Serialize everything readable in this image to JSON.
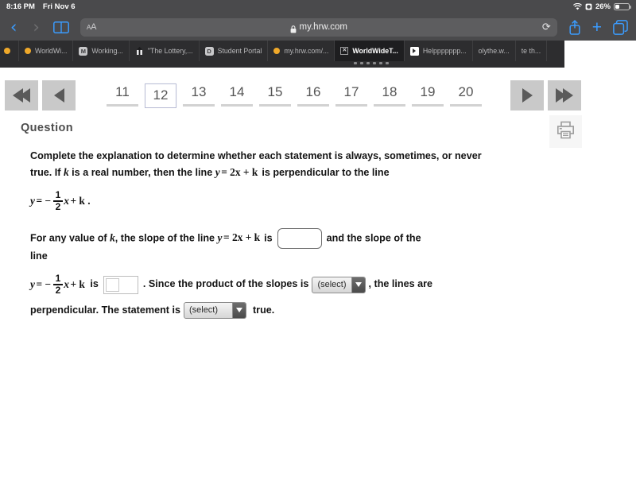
{
  "status_bar": {
    "time": "8:16 PM",
    "date": "Fri Nov 6",
    "battery_percent": "26%",
    "wifi_icon": "wifi-icon",
    "alarm_icon": "alarm-clock-icon",
    "battery_icon": "battery-icon"
  },
  "toolbar": {
    "back_icon": "chevron-left-icon",
    "forward_icon": "chevron-right-icon",
    "bookmarks_icon": "book-icon",
    "text_size_label": "A",
    "text_size_label_small": "A",
    "lock_icon": "lock-icon",
    "url": "my.hrw.com",
    "reload_icon": "reload-icon",
    "share_icon": "share-icon",
    "new_tab_icon": "plus-icon",
    "tabs_icon": "tabs-icon"
  },
  "tabs": [
    {
      "title": "",
      "favicon": "dot-favicon",
      "active": false
    },
    {
      "title": "WorldWi...",
      "favicon": "dot-favicon",
      "active": false
    },
    {
      "title": "Working...",
      "favicon": "letter-m-favicon",
      "active": false
    },
    {
      "title": "\"The Lottery,...",
      "favicon": "pin-favicon",
      "active": false
    },
    {
      "title": "Student Portal",
      "favicon": "letter-d-favicon",
      "active": false
    },
    {
      "title": "my.hrw.com/...",
      "favicon": "dot-favicon",
      "active": false
    },
    {
      "title": "WorldWideT...",
      "favicon": "x-favicon",
      "active": true
    },
    {
      "title": "Helppppppp...",
      "favicon": "play-favicon",
      "active": false
    },
    {
      "title": "olythe.w...",
      "favicon": "none",
      "active": false
    },
    {
      "title": "te th...",
      "favicon": "none",
      "active": false
    }
  ],
  "pager": {
    "first_icon": "double-chevron-left-icon",
    "prev_icon": "chevron-left-icon",
    "next_icon": "chevron-right-icon",
    "last_icon": "double-chevron-right-icon",
    "pages": [
      "11",
      "12",
      "13",
      "14",
      "15",
      "16",
      "17",
      "18",
      "19",
      "20"
    ],
    "current_page": "12"
  },
  "question": {
    "heading": "Question",
    "print_icon": "printer-icon",
    "intro_part1": "Complete the explanation to determine whether each statement is always, sometimes, or never true. If ",
    "intro_k": "k",
    "intro_part2": " is a real number, then the line ",
    "intro_eq_y": "y",
    "intro_eq_rest": "= 2x + k",
    "intro_part3": " is perpendicular to the line",
    "eq1_y": "y",
    "eq1_eq": "= −",
    "eq1_num": "1",
    "eq1_den": "2",
    "eq1_x": "x",
    "eq1_tail": "+ k .",
    "p2_a": "For any value of ",
    "p2_k": "k",
    "p2_b": ", the slope of the line ",
    "p2_eq_y": "y",
    "p2_eq_rest": "= 2x + k",
    "p2_is": " is",
    "p2_c": "and the slope of the",
    "p2_d": "line",
    "slope_input_1_value": "",
    "slope_input_2_value": "",
    "eq2_y": "y",
    "eq2_eq": "= −",
    "eq2_num": "1",
    "eq2_den": "2",
    "eq2_x": "x",
    "eq2_tail": "+ k",
    "eq2_is": "is",
    "p3_a": ". Since the product of the slopes is",
    "p3_b": ", the lines are",
    "p4_a": "perpendicular. The statement is",
    "p4_b": "true.",
    "select_product_value": "(select)",
    "select_truth_value": "(select)",
    "select_options": [
      "(select)"
    ]
  },
  "colors": {
    "chrome": "#4a4a4c",
    "tab_strip": "#2d2d2f",
    "tab_active": "#1e1e20",
    "accent_blue": "#3b9cff",
    "favicon_orange": "#f0a92a",
    "pager_button": "#c9c9c9",
    "pager_underline": "#d2d2d2",
    "page_bg": "#ffffff",
    "text_dark": "#141414"
  }
}
